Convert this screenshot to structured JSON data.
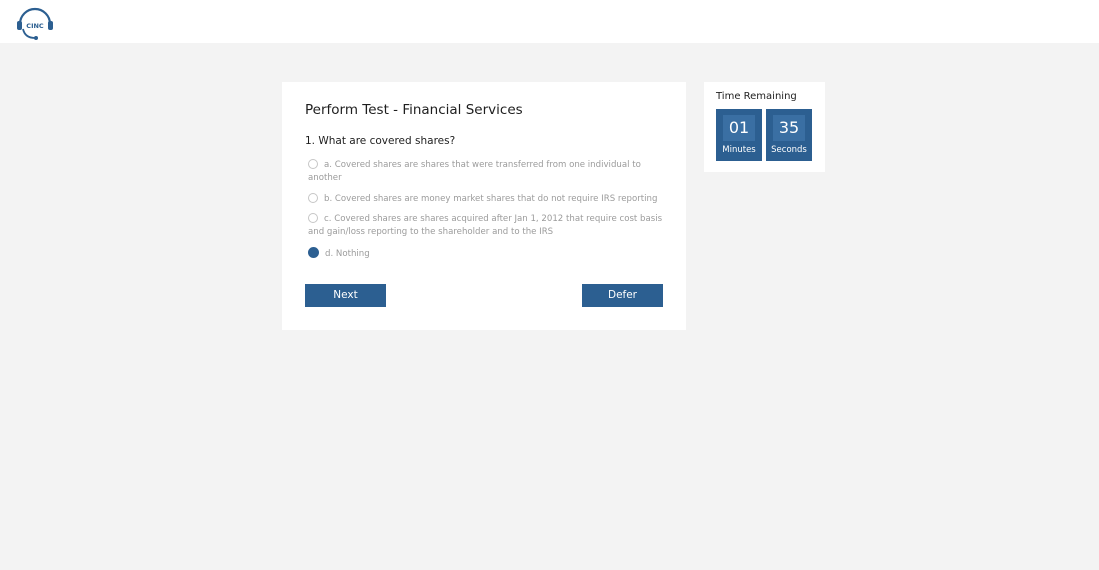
{
  "header": {
    "logo_text": "CINC"
  },
  "test": {
    "title": "Perform Test - Financial Services",
    "question": "1. What are covered shares?",
    "options": [
      {
        "label": "a. Covered shares are shares that were transferred from one individual to another",
        "selected": false
      },
      {
        "label": "b. Covered shares are money market shares that do not require IRS reporting",
        "selected": false
      },
      {
        "label": "c. Covered shares are shares acquired after Jan 1, 2012 that require cost basis and gain/loss reporting to the shareholder and to the IRS",
        "selected": false
      },
      {
        "label": "d. Nothing",
        "selected": true
      }
    ],
    "next_label": "Next",
    "defer_label": "Defer"
  },
  "timer": {
    "title": "Time Remaining",
    "minutes_value": "01",
    "minutes_label": "Minutes",
    "seconds_value": "35",
    "seconds_label": "Seconds"
  },
  "colors": {
    "accent": "#2c5f91",
    "background": "#f3f3f3"
  }
}
